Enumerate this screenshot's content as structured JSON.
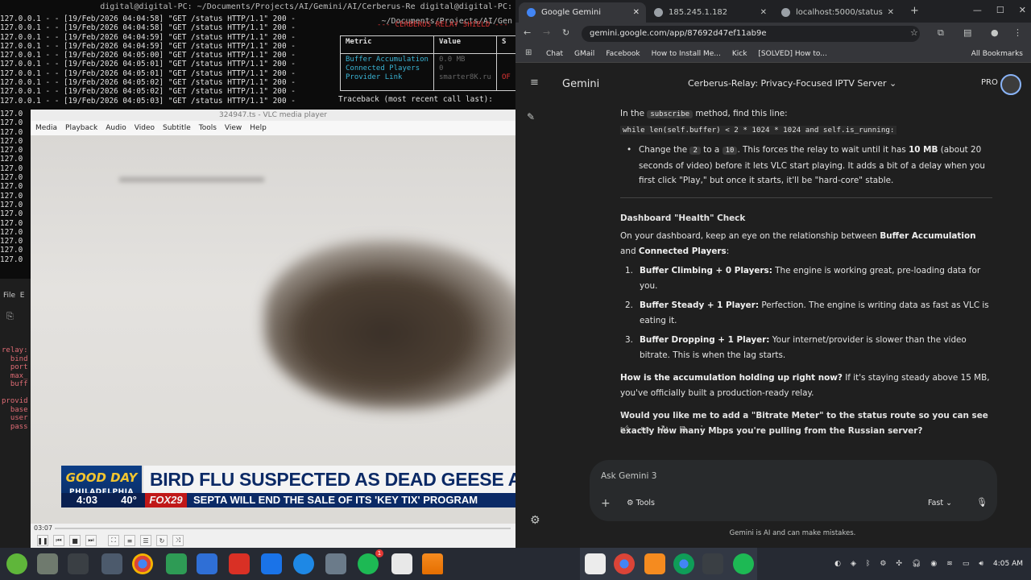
{
  "terminal": {
    "title": "digital@digital-PC: ~/Documents/Projects/AI/Gemini/AI/Cerberus-Re   digital@digital-PC: ~/Documents/Projects/AI/Gen",
    "log_lines": [
      "127.0.0.1 - - [19/Feb/2026 04:04:58] \"GET /status HTTP/1.1\" 200 -",
      "127.0.0.1 - - [19/Feb/2026 04:04:58] \"GET /status HTTP/1.1\" 200 -",
      "127.0.0.1 - - [19/Feb/2026 04:04:59] \"GET /status HTTP/1.1\" 200 -",
      "127.0.0.1 - - [19/Feb/2026 04:04:59] \"GET /status HTTP/1.1\" 200 -",
      "127.0.0.1 - - [19/Feb/2026 04:05:00] \"GET /status HTTP/1.1\" 200 -",
      "127.0.0.1 - - [19/Feb/2026 04:05:01] \"GET /status HTTP/1.1\" 200 -",
      "127.0.0.1 - - [19/Feb/2026 04:05:01] \"GET /status HTTP/1.1\" 200 -",
      "127.0.0.1 - - [19/Feb/2026 04:05:02] \"GET /status HTTP/1.1\" 200 -",
      "127.0.0.1 - - [19/Feb/2026 04:05:02] \"GET /status HTTP/1.1\" 200 -",
      "127.0.0.1 - - [19/Feb/2026 04:05:03] \"GET /status HTTP/1.1\" 200 -"
    ],
    "left_lines": "127.0\n127.0\n127.0\n127.0\n127.0\n127.0\n127.0\n127.0\n127.0\n127.0\n127.0\n127.0\n127.0\n127.0\n127.0\n127.0\n127.0",
    "shield_title": "--- CERBERUS RELAY SHIELD ---",
    "col_metric": "Metric",
    "col_value": "Value",
    "col_s": "S",
    "metrics": "Buffer Accumulation\nConnected Players\nProvider Link",
    "values": "0.0 MB\n0\nsmarter8K.ru",
    "status": "\n\nOF",
    "traceback": "Traceback (most recent call last):"
  },
  "ide": {
    "menu": "File  E",
    "code": "relay:\n  bind\n  port\n  max_\n  buff\n\nprovid\n  base\n  user\n  pass"
  },
  "vlc": {
    "title": "324947.ts - VLC media player",
    "menu": [
      "Media",
      "Playback",
      "Audio",
      "Video",
      "Subtitle",
      "Tools",
      "View",
      "Help"
    ],
    "logo_top": "GOOD DAY",
    "logo_bottom": "PHILADELPHIA",
    "headline": "BIRD FLU SUSPECTED AS DEAD GEESE ARE FOUND",
    "clock": "4:03",
    "temp": "40°",
    "station": "FOX29",
    "ticker": "SEPTA WILL END THE SALE OF ITS 'KEY TIX' PROGRAM",
    "elapsed": "03:07"
  },
  "chrome": {
    "tabs": [
      {
        "label": "Google Gemini",
        "color": "#4285f4"
      },
      {
        "label": "185.245.1.182",
        "color": "#9aa0a6"
      },
      {
        "label": "localhost:5000/status",
        "color": "#9aa0a6"
      }
    ],
    "url": "gemini.google.com/app/87692d47ef11ab9e",
    "bookmarks": [
      "Chat",
      "GMail",
      "Facebook",
      "How to Install Me...",
      "Kick",
      "[SOLVED] How to..."
    ],
    "all_bookmarks": "All Bookmarks"
  },
  "gemini": {
    "logo": "Gemini",
    "chat_title": "Cerberus-Relay: Privacy-Focused IPTV Server",
    "pro": "PRO",
    "p1_pre": "In the ",
    "p1_code": "subscribe",
    "p1_post": " method, find this line:",
    "code_line": "while len(self.buffer) < 2 * 1024 * 1024 and self.is_running:",
    "bullet_pre": "Change the ",
    "bullet_c1": "2",
    "bullet_mid": " to a ",
    "bullet_c2": "10",
    "bullet_mid2": ". This forces the relay to wait until it has ",
    "bullet_bold": "10 MB",
    "bullet_post": " (about 20 seconds of video) before it lets VLC start playing. It adds a bit of a delay when you first click \"Play,\" but once it starts, it'll be \"hard-core\" stable.",
    "heading": "Dashboard \"Health\" Check",
    "intro_pre": "On your dashboard, keep an eye on the relationship between ",
    "intro_b1": "Buffer Accumulation",
    "intro_mid": " and ",
    "intro_b2": "Connected Players",
    "intro_post": ":",
    "items": [
      {
        "n": "1.",
        "b": "Buffer Climbing + 0 Players:",
        "t": " The engine is working great, pre-loading data for you."
      },
      {
        "n": "2.",
        "b": "Buffer Steady + 1 Player:",
        "t": " Perfection. The engine is writing data as fast as VLC is eating it."
      },
      {
        "n": "3.",
        "b": "Buffer Dropping + 1 Player:",
        "t": " Your internet/provider is slower than the video bitrate. This is when the lag starts."
      }
    ],
    "q_bold": "How is the accumulation holding up right now?",
    "q_text": " If it's staying steady above 15 MB, you've officially built a production-ready relay.",
    "final": "Would you like me to add a \"Bitrate Meter\" to the status route so you can see exactly how many Mbps you're pulling from the Russian server?",
    "ask_placeholder": "Ask Gemini 3",
    "tools": "Tools",
    "mode": "Fast",
    "disclaimer": "Gemini is AI and can make mistakes."
  },
  "taskbar": {
    "clock": "4:05 AM",
    "badge": "1"
  }
}
